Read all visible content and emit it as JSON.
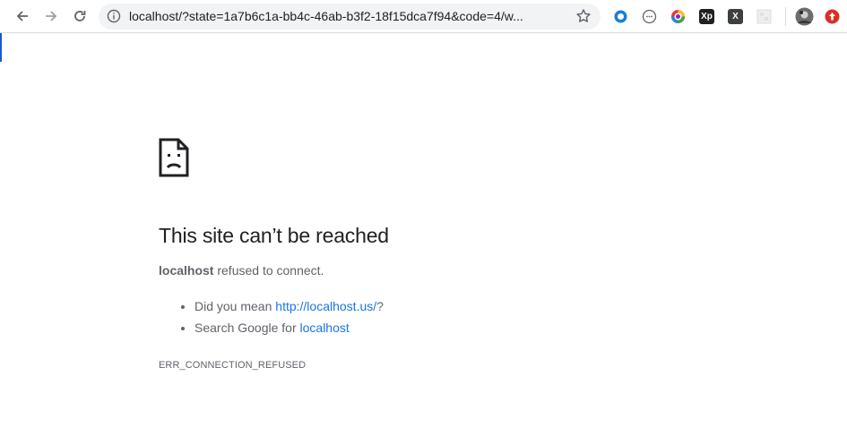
{
  "browser": {
    "url": "localhost/?state=1a7b6c1a-bb4c-46ab-b3f2-18f15dca7f94&code=4/w...",
    "extensions": [
      "circle-extension-icon",
      "dotted-circle-extension-icon",
      "color-wheel-extension-icon",
      "xp-extension-icon",
      "x-extension-icon",
      "blank-extension-icon",
      "profile-avatar",
      "update-icon"
    ],
    "xp_label": "Xp",
    "x_label": "X"
  },
  "error": {
    "title": "This site can’t be reached",
    "host": "localhost",
    "message_rest": " refused to connect.",
    "suggestions": {
      "did_you_mean_prefix": "Did you mean ",
      "did_you_mean_link": "http://localhost.us/",
      "did_you_mean_suffix": "?",
      "search_prefix": "Search Google for ",
      "search_link": "localhost"
    },
    "code": "ERR_CONNECTION_REFUSED"
  },
  "colors": {
    "link": "#1a73e8",
    "text": "#202124",
    "secondary_text": "#5f6368",
    "omnibox_bg": "#f1f3f4"
  }
}
